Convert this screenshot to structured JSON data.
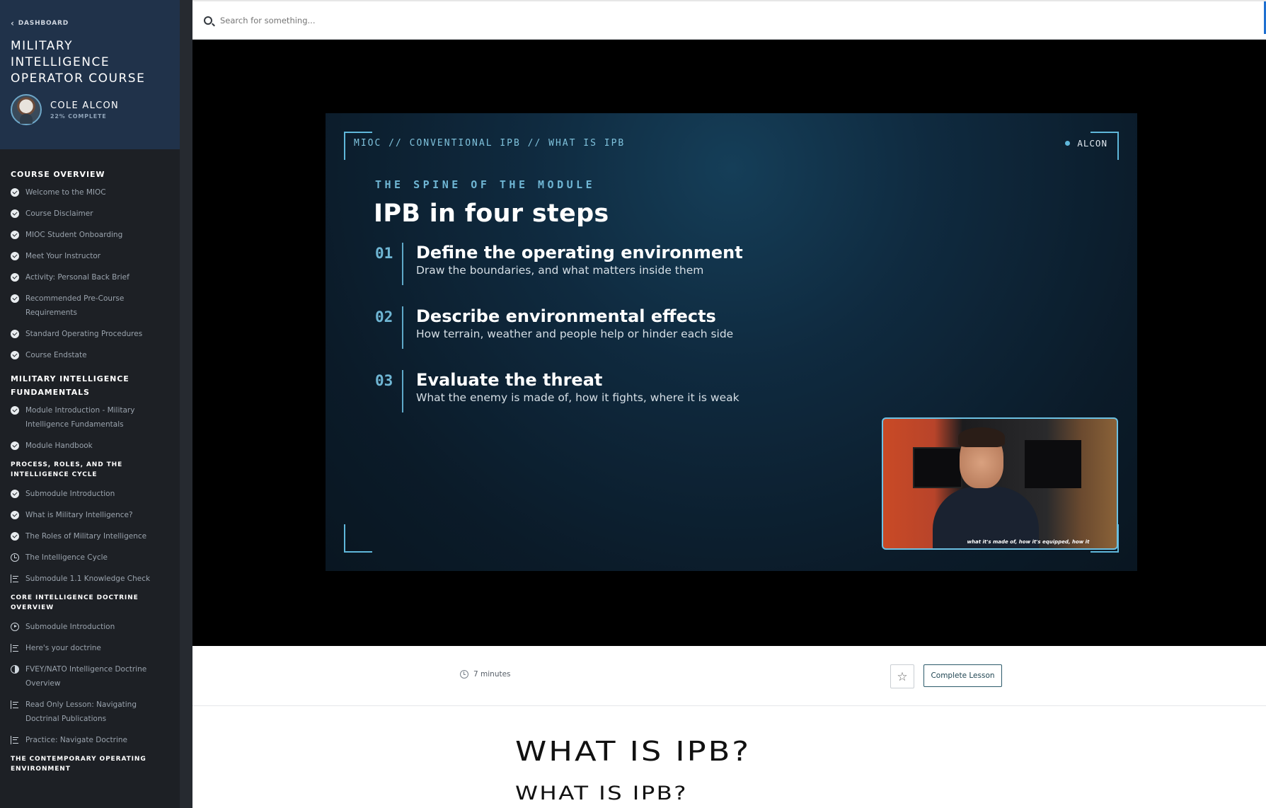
{
  "sidebar": {
    "back_label": "DASHBOARD",
    "course_title": "MILITARY INTELLIGENCE OPERATOR COURSE",
    "user": {
      "name": "COLE ALCON",
      "progress": "22% COMPLETE"
    },
    "sections": [
      {
        "title": "COURSE OVERVIEW",
        "size": "large",
        "items": [
          {
            "label": "Welcome to the MIOC",
            "icon": "check-circle-icon"
          },
          {
            "label": "Course Disclaimer",
            "icon": "check-circle-icon"
          },
          {
            "label": "MIOC Student Onboarding",
            "icon": "check-circle-icon"
          },
          {
            "label": "Meet Your Instructor",
            "icon": "check-circle-icon"
          },
          {
            "label": "Activity: Personal Back Brief",
            "icon": "check-circle-icon"
          },
          {
            "label": "Recommended Pre-Course Requirements",
            "icon": "check-circle-icon"
          },
          {
            "label": "Standard Operating Procedures",
            "icon": "check-circle-icon"
          },
          {
            "label": "Course Endstate",
            "icon": "check-circle-icon"
          }
        ]
      },
      {
        "title": "MILITARY INTELLIGENCE FUNDAMENTALS",
        "size": "large",
        "items": [
          {
            "label": "Module Introduction - Military Intelligence Fundamentals",
            "icon": "check-circle-icon"
          },
          {
            "label": "Module Handbook",
            "icon": "check-circle-icon"
          }
        ]
      },
      {
        "title": "PROCESS, ROLES, AND THE INTELLIGENCE CYCLE",
        "size": "small",
        "items": [
          {
            "label": "Submodule Introduction",
            "icon": "check-circle-icon"
          },
          {
            "label": "What is Military Intelligence?",
            "icon": "check-circle-icon"
          },
          {
            "label": "The Roles of Military Intelligence",
            "icon": "check-circle-icon"
          },
          {
            "label": "The Intelligence Cycle",
            "icon": "clock-icon"
          },
          {
            "label": "Submodule 1.1 Knowledge Check",
            "icon": "document-icon"
          }
        ]
      },
      {
        "title": "CORE INTELLIGENCE DOCTRINE OVERVIEW",
        "size": "small",
        "items": [
          {
            "label": "Submodule Introduction",
            "icon": "play-circle-icon"
          },
          {
            "label": "Here's your doctrine",
            "icon": "document-icon"
          },
          {
            "label": "FVEY/NATO Intelligence Doctrine Overview",
            "icon": "half-circle-icon"
          },
          {
            "label": "Read Only Lesson: Navigating Doctrinal Publications",
            "icon": "document-icon"
          },
          {
            "label": "Practice: Navigate Doctrine",
            "icon": "document-icon"
          }
        ]
      },
      {
        "title": "THE CONTEMPORARY OPERATING ENVIRONMENT",
        "size": "small",
        "items": []
      }
    ]
  },
  "search": {
    "placeholder": "Search for something..."
  },
  "slide": {
    "breadcrumb": "MIOC // CONVENTIONAL IPB // WHAT IS IPB",
    "badge": "ALCON",
    "kicker": "THE SPINE OF THE MODULE",
    "title": "IPB in four steps",
    "steps": [
      {
        "num": "01",
        "heading": "Define the operating environment",
        "sub": "Draw the boundaries, and what matters inside them"
      },
      {
        "num": "02",
        "heading": "Describe environmental effects",
        "sub": "How terrain, weather and people help or hinder each side"
      },
      {
        "num": "03",
        "heading": "Evaluate the threat",
        "sub": "What the enemy is made of, how it fights, where it is weak"
      }
    ],
    "caption": "what it's made of, how it's equipped, how it"
  },
  "lesson": {
    "duration": "7 minutes",
    "complete_label": "Complete Lesson",
    "favorite_icon": "star-icon",
    "heading1": "WHAT IS IPB?",
    "heading2": "WHAT IS IPB?"
  },
  "colors": {
    "accent": "#5fb7da",
    "sidebar_bg": "#1d2025",
    "sidebar_header": "#20324a"
  }
}
